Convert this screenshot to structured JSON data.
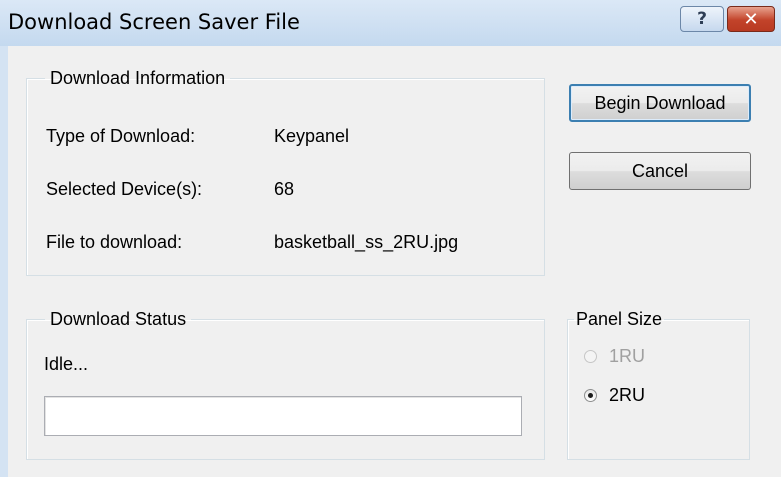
{
  "window": {
    "title": "Download Screen Saver File",
    "help_glyph": "?",
    "close_glyph": "✕"
  },
  "download_info": {
    "legend": "Download Information",
    "rows": [
      {
        "label": "Type of Download:",
        "value": "Keypanel"
      },
      {
        "label": "Selected Device(s):",
        "value": "68"
      },
      {
        "label": "File to download:",
        "value": "basketball_ss_2RU.jpg"
      }
    ]
  },
  "buttons": {
    "begin_download": "Begin Download",
    "cancel": "Cancel"
  },
  "download_status": {
    "legend": "Download Status",
    "status_text": "Idle...",
    "progress_fraction": 0
  },
  "panel_size": {
    "legend": "Panel Size",
    "options": [
      {
        "label": "1RU",
        "checked": false,
        "enabled": false
      },
      {
        "label": "2RU",
        "checked": true,
        "enabled": true
      }
    ]
  },
  "colors": {
    "title_bar": "#c4d9ef",
    "client_bg": "#f0f0f0",
    "close_button": "#c2432a",
    "default_button_border": "#3c7fb1"
  },
  "icons": {
    "help": "help-icon",
    "close": "close-icon"
  }
}
